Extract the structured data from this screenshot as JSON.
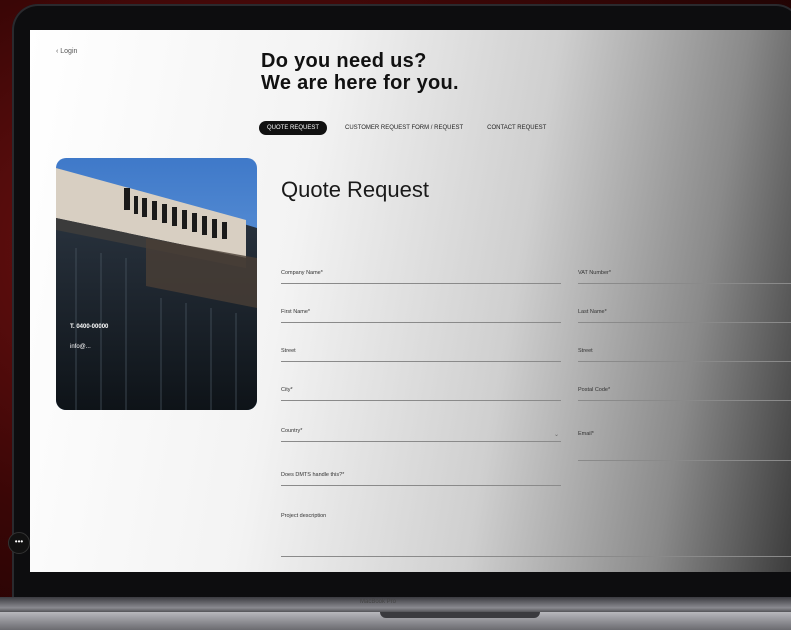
{
  "header": {
    "back_label": "‹ Login",
    "title_line1": "Do you need us?",
    "title_line2": "We are here for you.",
    "right_note": ""
  },
  "tabs": [
    {
      "label": "QUOTE REQUEST",
      "active": true
    },
    {
      "label": "CUSTOMER REQUEST FORM / REQUEST",
      "active": false
    },
    {
      "label": "CONTACT REQUEST",
      "active": false
    }
  ],
  "contact": {
    "phone": "T. 0400-00000",
    "email": "info@..."
  },
  "form": {
    "title": "Quote Request",
    "description": "",
    "fields_left": [
      {
        "label": "Company Name*",
        "value": ""
      },
      {
        "label": "First Name*",
        "value": ""
      },
      {
        "label": "Street",
        "value": ""
      },
      {
        "label": "City*",
        "value": ""
      },
      {
        "label": "Country*",
        "value": "",
        "caret": "⌄"
      },
      {
        "label": "Does DMTS handle this?*",
        "value": ""
      },
      {
        "label": "Project description",
        "value": ""
      }
    ],
    "fields_right": [
      {
        "label": "VAT Number*",
        "value": ""
      },
      {
        "label": "Last Name*",
        "value": ""
      },
      {
        "label": "Street",
        "value": ""
      },
      {
        "label": "Postal Code*",
        "value": ""
      },
      {
        "label": "Email*",
        "value": ""
      }
    ]
  },
  "chat": {
    "icon": "chat-icon",
    "glyph": "•••"
  },
  "device": {
    "model_label": "MacBook Pro"
  },
  "colors": {
    "accent_dark": "#111111",
    "background_red": "#7a1414"
  }
}
